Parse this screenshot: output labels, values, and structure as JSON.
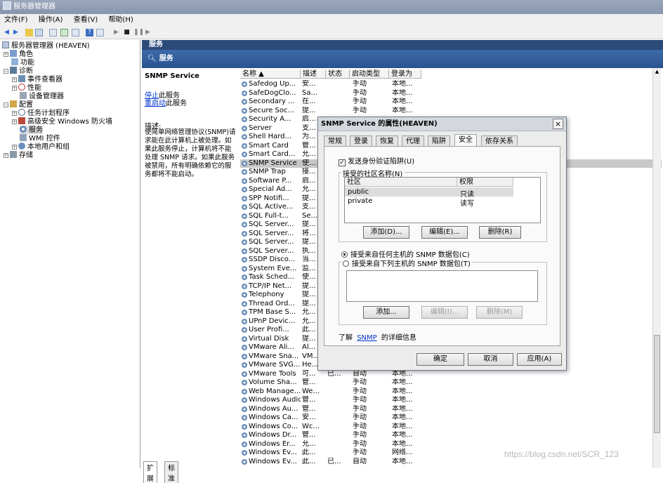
{
  "window": {
    "title": "服务器管理器"
  },
  "menu": [
    "文件(F)",
    "操作(A)",
    "查看(V)",
    "帮助(H)"
  ],
  "tree": [
    {
      "label": "服务器管理器 (HEAVEN)",
      "indent": 0,
      "exp": ""
    },
    {
      "label": "角色",
      "indent": 1,
      "exp": "+"
    },
    {
      "label": "功能",
      "indent": 1,
      "exp": ""
    },
    {
      "label": "诊断",
      "indent": 1,
      "exp": "-"
    },
    {
      "label": "事件查看器",
      "indent": 2,
      "exp": "+"
    },
    {
      "label": "性能",
      "indent": 2,
      "exp": "+"
    },
    {
      "label": "设备管理器",
      "indent": 2,
      "exp": ""
    },
    {
      "label": "配置",
      "indent": 1,
      "exp": "-"
    },
    {
      "label": "任务计划程序",
      "indent": 2,
      "exp": "+"
    },
    {
      "label": "高级安全 Windows 防火墙",
      "indent": 2,
      "exp": "+"
    },
    {
      "label": "服务",
      "indent": 2,
      "exp": ""
    },
    {
      "label": "WMI 控件",
      "indent": 2,
      "exp": ""
    },
    {
      "label": "本地用户和组",
      "indent": 2,
      "exp": "+"
    },
    {
      "label": "存储",
      "indent": 1,
      "exp": "+"
    }
  ],
  "header": {
    "section": "服务",
    "pane_title": "服务"
  },
  "desc": {
    "title": "SNMP Service",
    "stop": "停止",
    "stop_rest": "此服务",
    "restart": "重启动",
    "restart_rest": "此服务",
    "desc_label": "描述:",
    "desc_lines": [
      "使简单网络管理协议(SNMP)请",
      "求能在此计算机上被处理。如",
      "果此服务停止，计算机将不能",
      "处理 SNMP 请求。如果此服务",
      "被禁用，所有明确依赖它的服",
      "务都将不能启动。"
    ]
  },
  "columns": [
    "名称 ▲",
    "描述",
    "状态",
    "启动类型",
    "登录为"
  ],
  "services": [
    {
      "name": "Safedog Up...",
      "desc": "安...",
      "status": "",
      "start": "手动",
      "logon": "本地..."
    },
    {
      "name": "SafeDogClo...",
      "desc": "Sa...",
      "status": "",
      "start": "手动",
      "logon": "本地..."
    },
    {
      "name": "Secondary ...",
      "desc": "在...",
      "status": "",
      "start": "手动",
      "logon": "本地..."
    },
    {
      "name": "Secure Soc...",
      "desc": "提...",
      "status": "",
      "start": "手动",
      "logon": "本地..."
    },
    {
      "name": "Security A...",
      "desc": "启...",
      "status": "",
      "start": "",
      "logon": ""
    },
    {
      "name": "Server",
      "desc": "支...",
      "status": "",
      "start": "",
      "logon": ""
    },
    {
      "name": "Shell Hard...",
      "desc": "为...",
      "status": "",
      "start": "",
      "logon": ""
    },
    {
      "name": "Smart Card",
      "desc": "管...",
      "status": "",
      "start": "",
      "logon": ""
    },
    {
      "name": "Smart Card...",
      "desc": "允...",
      "status": "",
      "start": "",
      "logon": ""
    },
    {
      "name": "SNMP Service",
      "desc": "使...",
      "status": "",
      "start": "",
      "logon": "",
      "selected": true
    },
    {
      "name": "SNMP Trap",
      "desc": "接...",
      "status": "",
      "start": "",
      "logon": ""
    },
    {
      "name": "Software P...",
      "desc": "启...",
      "status": "",
      "start": "",
      "logon": ""
    },
    {
      "name": "Special Ad...",
      "desc": "允...",
      "status": "",
      "start": "",
      "logon": ""
    },
    {
      "name": "SPP Notifi...",
      "desc": "提...",
      "status": "",
      "start": "",
      "logon": ""
    },
    {
      "name": "SQL Active...",
      "desc": "支...",
      "status": "",
      "start": "",
      "logon": ""
    },
    {
      "name": "SQL Full-t...",
      "desc": "Se...",
      "status": "",
      "start": "",
      "logon": ""
    },
    {
      "name": "SQL Server...",
      "desc": "提...",
      "status": "",
      "start": "",
      "logon": ""
    },
    {
      "name": "SQL Server...",
      "desc": "将...",
      "status": "",
      "start": "",
      "logon": ""
    },
    {
      "name": "SQL Server...",
      "desc": "提...",
      "status": "",
      "start": "",
      "logon": ""
    },
    {
      "name": "SQL Server...",
      "desc": "执...",
      "status": "",
      "start": "",
      "logon": ""
    },
    {
      "name": "SSDP Disco...",
      "desc": "当...",
      "status": "",
      "start": "",
      "logon": ""
    },
    {
      "name": "System Eve...",
      "desc": "监...",
      "status": "",
      "start": "",
      "logon": ""
    },
    {
      "name": "Task Sched...",
      "desc": "使...",
      "status": "",
      "start": "",
      "logon": ""
    },
    {
      "name": "TCP/IP Net...",
      "desc": "提...",
      "status": "",
      "start": "",
      "logon": ""
    },
    {
      "name": "Telephony",
      "desc": "提...",
      "status": "",
      "start": "",
      "logon": ""
    },
    {
      "name": "Thread Ord...",
      "desc": "提...",
      "status": "",
      "start": "",
      "logon": ""
    },
    {
      "name": "TPM Base S...",
      "desc": "允...",
      "status": "",
      "start": "",
      "logon": ""
    },
    {
      "name": "UPnP Devic...",
      "desc": "允...",
      "status": "",
      "start": "",
      "logon": ""
    },
    {
      "name": "User Profi...",
      "desc": "此...",
      "status": "",
      "start": "",
      "logon": ""
    },
    {
      "name": "Virtual Disk",
      "desc": "提...",
      "status": "",
      "start": "",
      "logon": ""
    },
    {
      "name": "VMware Ali...",
      "desc": "Al...",
      "status": "",
      "start": "",
      "logon": ""
    },
    {
      "name": "VMware Sna...",
      "desc": "VM...",
      "status": "",
      "start": "",
      "logon": ""
    },
    {
      "name": "VMware SVG...",
      "desc": "He...",
      "status": "",
      "start": "",
      "logon": ""
    },
    {
      "name": "VMware Tools",
      "desc": "可...",
      "status": "已...",
      "start": "自动",
      "logon": "本地..."
    },
    {
      "name": "Volume Sha...",
      "desc": "管...",
      "status": "",
      "start": "手动",
      "logon": "本地..."
    },
    {
      "name": "Web Manage...",
      "desc": "We...",
      "status": "",
      "start": "手动",
      "logon": "本地..."
    },
    {
      "name": "Windows Audio",
      "desc": "管...",
      "status": "",
      "start": "手动",
      "logon": "本地..."
    },
    {
      "name": "Windows Au...",
      "desc": "管...",
      "status": "",
      "start": "手动",
      "logon": "本地..."
    },
    {
      "name": "Windows Ca...",
      "desc": "安...",
      "status": "",
      "start": "手动",
      "logon": "本地..."
    },
    {
      "name": "Windows Co...",
      "desc": "Wc...",
      "status": "",
      "start": "手动",
      "logon": "本地..."
    },
    {
      "name": "Windows Dr...",
      "desc": "管...",
      "status": "",
      "start": "手动",
      "logon": "本地..."
    },
    {
      "name": "Windows Er...",
      "desc": "允...",
      "status": "",
      "start": "手动",
      "logon": "本地..."
    },
    {
      "name": "Windows Ev...",
      "desc": "此...",
      "status": "",
      "start": "手动",
      "logon": "网络..."
    },
    {
      "name": "Windows Ev...",
      "desc": "此...",
      "status": "已...",
      "start": "自动",
      "logon": "本地..."
    }
  ],
  "bottom_tabs": [
    "扩展",
    "标准"
  ],
  "dialog": {
    "title": "SNMP Service 的属性(HEAVEN)",
    "close": "×",
    "tabs": [
      "常规",
      "登录",
      "恢复",
      "代理",
      "陷阱",
      "安全",
      "依存关系"
    ],
    "send_auth_trap": "发送身份验证陷阱(U)",
    "communities_label": "接受的社区名称(N)",
    "community_cols": [
      "社区",
      "权限"
    ],
    "communities": [
      {
        "name": "public",
        "right": "只读"
      },
      {
        "name": "private",
        "right": "读写"
      }
    ],
    "add1": "添加(D)...",
    "edit1": "编辑(E)...",
    "remove1": "删除(R)",
    "radio_any": "接受来自任何主机的 SNMP 数据包(C)",
    "radio_these": "接受来自下列主机的 SNMP 数据包(T)",
    "add2": "添加...",
    "edit2": "编辑(I)...",
    "remove2": "删除(M)",
    "learn_prefix": "了解",
    "learn_link": "SNMP",
    "learn_suffix": "的详细信息",
    "ok": "确定",
    "cancel": "取消",
    "apply": "应用(A)"
  },
  "watermark": "https://blog.csdn.net/SCR_123"
}
